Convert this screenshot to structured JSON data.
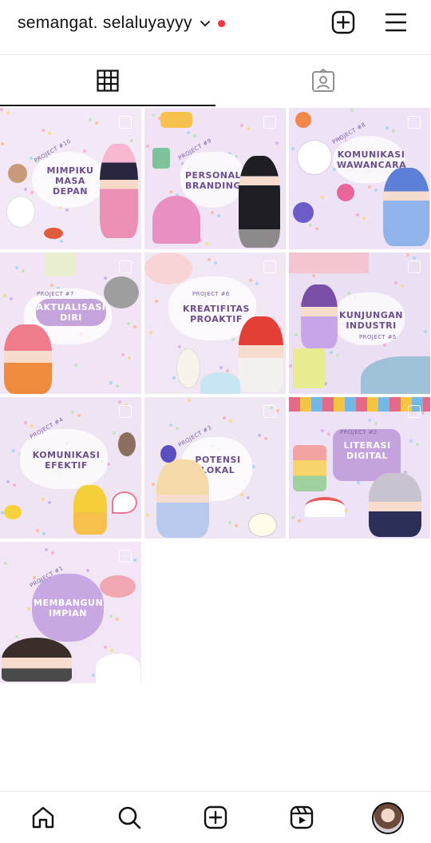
{
  "header": {
    "username": "semangat. selaluyayyy",
    "icons": [
      "chevron-down-icon",
      "notification-dot",
      "new-post-icon",
      "menu-icon"
    ]
  },
  "tabs": [
    {
      "icon": "grid-icon",
      "active": true
    },
    {
      "icon": "tagged-icon",
      "active": false
    }
  ],
  "posts": [
    {
      "project": "PROJECT #10",
      "title": "MIMPIKU\nMASA\nDEPAN"
    },
    {
      "project": "PROJECT #9",
      "title": "PERSONAL\nBRANDING"
    },
    {
      "project": "PROJECT #8",
      "title": "KOMUNIKASI\nWAWANCARA"
    },
    {
      "project": "PROJECT #7",
      "title": "AKTUALISASI\nDIRI"
    },
    {
      "project": "PROJECT #6",
      "title": "KREATIFITAS\nPROAKTIF"
    },
    {
      "project": "PROJECT #5",
      "title": "KUNJUNGAN\nINDUSTRI"
    },
    {
      "project": "PROJECT #4",
      "title": "KOMUNIKASI\nEFEKTIF"
    },
    {
      "project": "PROJECT #3",
      "title": "POTENSI\nLOKAL"
    },
    {
      "project": "PROJECT #2",
      "title": "LITERASI\nDIGITAL"
    },
    {
      "project": "PROJECT #1",
      "title": "MEMBANGUN\nIMPIAN"
    }
  ],
  "bottom_nav": [
    "home-icon",
    "search-icon",
    "create-icon",
    "reels-icon",
    "profile-avatar"
  ],
  "colors": {
    "accent_dot": "#ff3040",
    "tile_bg": "#efe3f5",
    "label": "#6b4f8c"
  }
}
